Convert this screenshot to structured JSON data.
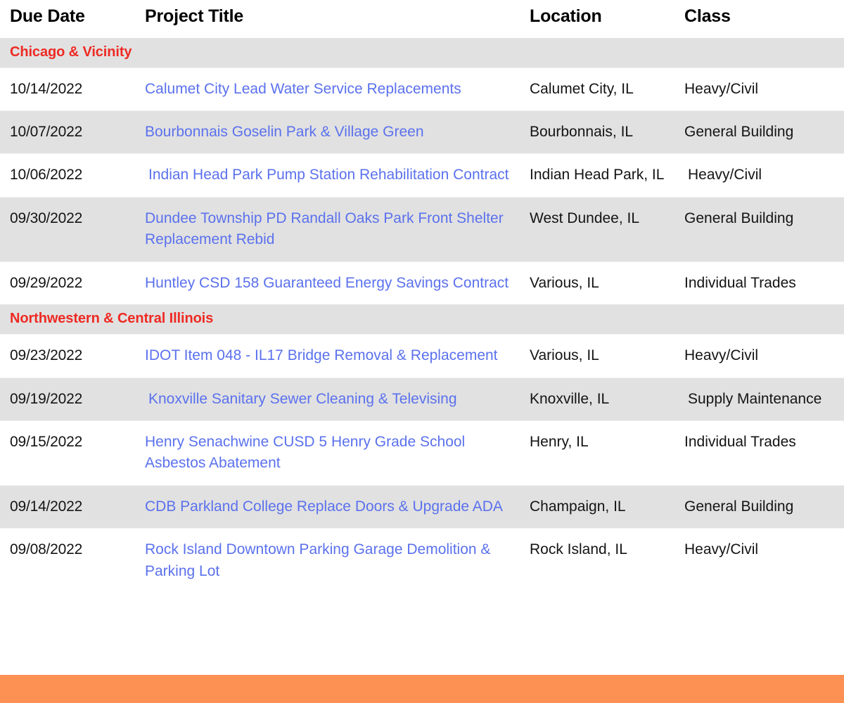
{
  "table": {
    "columns": [
      {
        "key": "due_date",
        "label": "Due Date"
      },
      {
        "key": "project_title",
        "label": "Project Title"
      },
      {
        "key": "location",
        "label": "Location"
      },
      {
        "key": "class",
        "label": "Class"
      }
    ],
    "sections": [
      {
        "title": "Chicago & Vicinity",
        "rows": [
          {
            "due_date": "10/14/2022",
            "project_title": "Calumet City Lead Water Service Replacements",
            "location": "Calumet City, IL",
            "class": "Heavy/Civil"
          },
          {
            "due_date": "10/07/2022",
            "project_title": "Bourbonnais Goselin Park & Village Green",
            "location": "Bourbonnais, IL",
            "class": "General Building"
          },
          {
            "due_date": "10/06/2022",
            "project_title": "Indian Head Park Pump Station Rehabilitation Contract",
            "location": "Indian Head Park, IL",
            "class": "Heavy/Civil"
          },
          {
            "due_date": "09/30/2022",
            "project_title": "Dundee Township PD Randall Oaks Park Front Shelter Replacement Rebid",
            "location": "West Dundee, IL",
            "class": "General Building"
          },
          {
            "due_date": "09/29/2022",
            "project_title": "Huntley CSD 158 Guaranteed Energy Savings Contract",
            "location": "Various, IL",
            "class": "Individual Trades"
          }
        ]
      },
      {
        "title": "Northwestern & Central Illinois",
        "rows": [
          {
            "due_date": "09/23/2022",
            "project_title": "IDOT Item 048 - IL17 Bridge Removal & Replacement",
            "location": "Various, IL",
            "class": "Heavy/Civil"
          },
          {
            "due_date": "09/19/2022",
            "project_title": "Knoxville Sanitary Sewer Cleaning & Televising",
            "location": "Knoxville, IL",
            "class": "Supply Maintenance"
          },
          {
            "due_date": "09/15/2022",
            "project_title": "Henry Senachwine CUSD 5 Henry Grade School Asbestos Abatement",
            "location": "Henry, IL",
            "class": "Individual Trades"
          },
          {
            "due_date": "09/14/2022",
            "project_title": "CDB Parkland College Replace Doors & Upgrade ADA",
            "location": "Champaign, IL",
            "class": "General Building"
          },
          {
            "due_date": "09/08/2022",
            "project_title": "Rock Island Downtown Parking Garage Demolition & Parking Lot",
            "location": "Rock Island, IL",
            "class": "Heavy/Civil"
          }
        ]
      }
    ]
  },
  "colors": {
    "section_header_text": "#ee2a23",
    "link": "#5b71ed",
    "row_shade": "#e1e1e1",
    "row_plain": "#ffffff",
    "footer_bar": "#fc9153",
    "body_text": "#141414"
  }
}
